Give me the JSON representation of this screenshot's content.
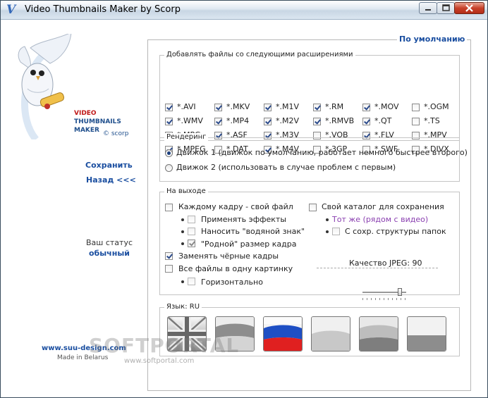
{
  "window": {
    "title": "Video Thumbnails Maker by Scorp"
  },
  "logo": {
    "line1": "VIDEO",
    "line2": "THUMBNAILS",
    "line3": "MAKER",
    "copyright": "© scorp"
  },
  "sidebar": {
    "save": "Сохранить",
    "back": "Назад <<<",
    "status_label": "Ваш статус",
    "status_value": "обычный",
    "site": "www.suu-design.com",
    "made_in": "Made in Belarus"
  },
  "watermark": {
    "big": "SOFTPORTAL",
    "small": "www.softportal.com"
  },
  "profile": "По умолчанию",
  "extensions": {
    "legend": "Добавлять файлы со следующими  расширениями",
    "items": [
      {
        "label": "*.AVI",
        "checked": true
      },
      {
        "label": "*.MKV",
        "checked": true
      },
      {
        "label": "*.M1V",
        "checked": true
      },
      {
        "label": "*.RM",
        "checked": true
      },
      {
        "label": "*.MOV",
        "checked": true
      },
      {
        "label": "*.OGM",
        "checked": false
      },
      {
        "label": "*.WMV",
        "checked": true
      },
      {
        "label": "*.MP4",
        "checked": true
      },
      {
        "label": "*.M2V",
        "checked": true
      },
      {
        "label": "*.RMVB",
        "checked": true
      },
      {
        "label": "*.QT",
        "checked": true
      },
      {
        "label": "*.TS",
        "checked": false
      },
      {
        "label": "*.MPG",
        "checked": true
      },
      {
        "label": "*.ASF",
        "checked": true
      },
      {
        "label": "*.M3V",
        "checked": true
      },
      {
        "label": "*.VOB",
        "checked": false
      },
      {
        "label": "*.FLV",
        "checked": true
      },
      {
        "label": "*.MPV",
        "checked": false
      },
      {
        "label": "*.MPEG",
        "checked": true
      },
      {
        "label": "*.DAT",
        "checked": false
      },
      {
        "label": "*.M4V",
        "checked": true
      },
      {
        "label": "*.3GP",
        "checked": false
      },
      {
        "label": "*.SWF",
        "checked": false
      },
      {
        "label": "*.DIVX",
        "checked": false
      }
    ]
  },
  "rendering": {
    "legend": "Рендеринг",
    "engine1": "Движок 1 (движок по умолчанию, работает немного быстрее второго)",
    "engine2": "Движок 2 (использовать в случае проблем с первым)"
  },
  "output": {
    "legend": "На выходе",
    "per_frame": "Каждому кадру - свой файл",
    "apply_effects": "Применять эффекты",
    "watermark": "Наносить \"водяной знак\"",
    "native_size": "\"Родной\" размер кадра",
    "replace_black": "Заменять чёрные кадры",
    "all_in_one": "Все файлы в одну картинку",
    "horizontal": "Горизонтально",
    "own_dir": "Свой каталог для сохранения",
    "same_dir": "Тот же (рядом с видео)",
    "keep_struct": "С сохр. структуры папок",
    "jpeg_quality": "Качество JPEG: 90"
  },
  "language": {
    "legend": "Язык:",
    "value": "RU"
  },
  "colors": {
    "accent": "#1a4ea0",
    "purple": "#8a3fb0",
    "logo_red": "#c01818"
  }
}
